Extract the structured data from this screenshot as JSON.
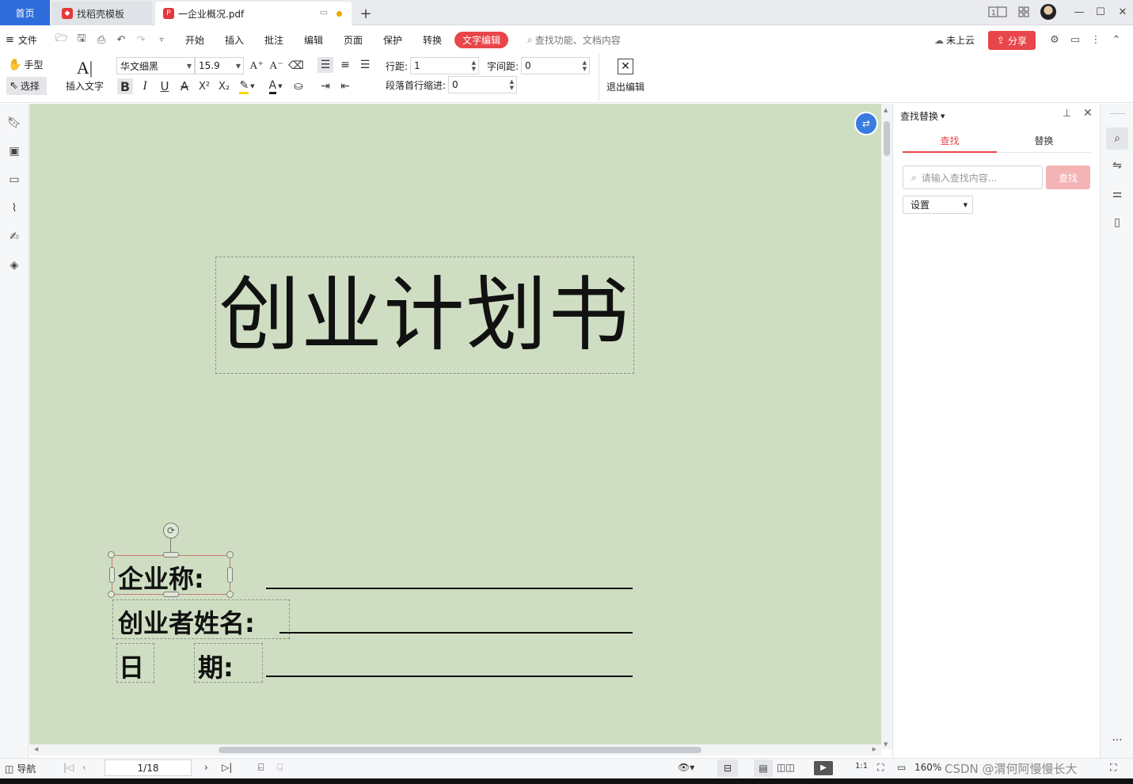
{
  "tabs": {
    "home": "首页",
    "template": "找稻壳模板",
    "document": "一企业概况.pdf",
    "new_tab": "+"
  },
  "menu": {
    "file": "文件",
    "items": [
      "开始",
      "插入",
      "批注",
      "编辑",
      "页面",
      "保护",
      "转换"
    ],
    "active": "文字编辑",
    "search_placeholder": "查找功能、文档内容",
    "cloud": "未上云",
    "share": "分享"
  },
  "toolbar": {
    "hand": "手型",
    "select": "选择",
    "insert_text": "插入文字",
    "font_name": "华文细黑",
    "font_size": "15.9",
    "line_spacing_label": "行距:",
    "line_spacing_value": "1",
    "char_spacing_label": "字间距:",
    "char_spacing_value": "0",
    "indent_label": "段落首行缩进:",
    "indent_value": "0",
    "exit_edit": "退出编辑"
  },
  "document": {
    "title": "创业计划书",
    "fields": {
      "company": "企业称:",
      "founder": "创业者姓名:",
      "date_1": "日",
      "date_2": "期:"
    }
  },
  "find_panel": {
    "title": "查找替换",
    "tab_find": "查找",
    "tab_replace": "替换",
    "search_placeholder": "请输入查找内容...",
    "find_button": "查找",
    "settings": "设置"
  },
  "status": {
    "nav": "导航",
    "page": "1/18",
    "zoom": "160%",
    "watermark": "CSDN @渭何阿慢慢长大"
  },
  "colors": {
    "accent_blue": "#2f6cdb",
    "accent_red": "#e8464a",
    "doc_background": "#cfdec2"
  }
}
